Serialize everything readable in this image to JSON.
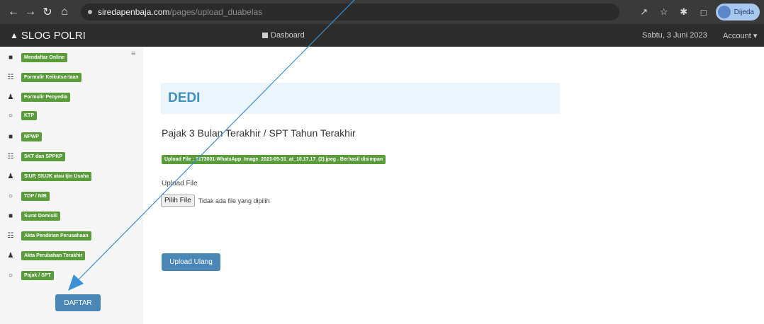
{
  "browser": {
    "url_domain": "siredapenbaja.com",
    "url_path": "/pages/upload_duabelas",
    "profile_label": "Dijeda"
  },
  "navbar": {
    "brand": "SLOG POLRI",
    "dashboard": "Dasboard",
    "date": "Sabtu, 3 Juni 2023",
    "account": "Account"
  },
  "sidebar": {
    "items": [
      {
        "label": "Mendaftar Online",
        "icon": "briefcase-icon"
      },
      {
        "label": "Formulir Keikutsertaan",
        "icon": "grid-icon"
      },
      {
        "label": "Formulir Penyedia",
        "icon": "user-icon"
      },
      {
        "label": "KTP",
        "icon": "circle-icon"
      },
      {
        "label": "NPWP",
        "icon": "briefcase-icon"
      },
      {
        "label": "SKT dan SPPKP",
        "icon": "grid-icon"
      },
      {
        "label": "SIUP, SIUJK atau Ijin Usaha",
        "icon": "user-icon"
      },
      {
        "label": "TDP / NIB",
        "icon": "circle-icon"
      },
      {
        "label": "Surat Domisili",
        "icon": "briefcase-icon"
      },
      {
        "label": "Akta Pendirian Perusahaan",
        "icon": "grid-icon"
      },
      {
        "label": "Akta Perubahan Terakhir",
        "icon": "user-icon"
      },
      {
        "label": "Pajak / SPT",
        "icon": "circle-icon"
      }
    ],
    "daftar_button": "DAFTAR"
  },
  "main": {
    "title": "DEDI",
    "subtitle": "Pajak 3 Bulan Terakhir / SPT Tahun Terakhir",
    "success_message": "Upload File : 3173001-WhatsApp_Image_2023-05-31_at_10.17.17_(2).jpeg . Berhasil disimpan",
    "upload_label": "Upload File",
    "file_button": "Pilih File",
    "file_status": "Tidak ada file yang dipilih",
    "reupload_button": "Upload Ulang"
  },
  "colors": {
    "badge_green": "#5a9b3a",
    "button_blue": "#4a86b6",
    "title_blue": "#3f8fc3",
    "annotation_blue": "#3b8fd6"
  }
}
